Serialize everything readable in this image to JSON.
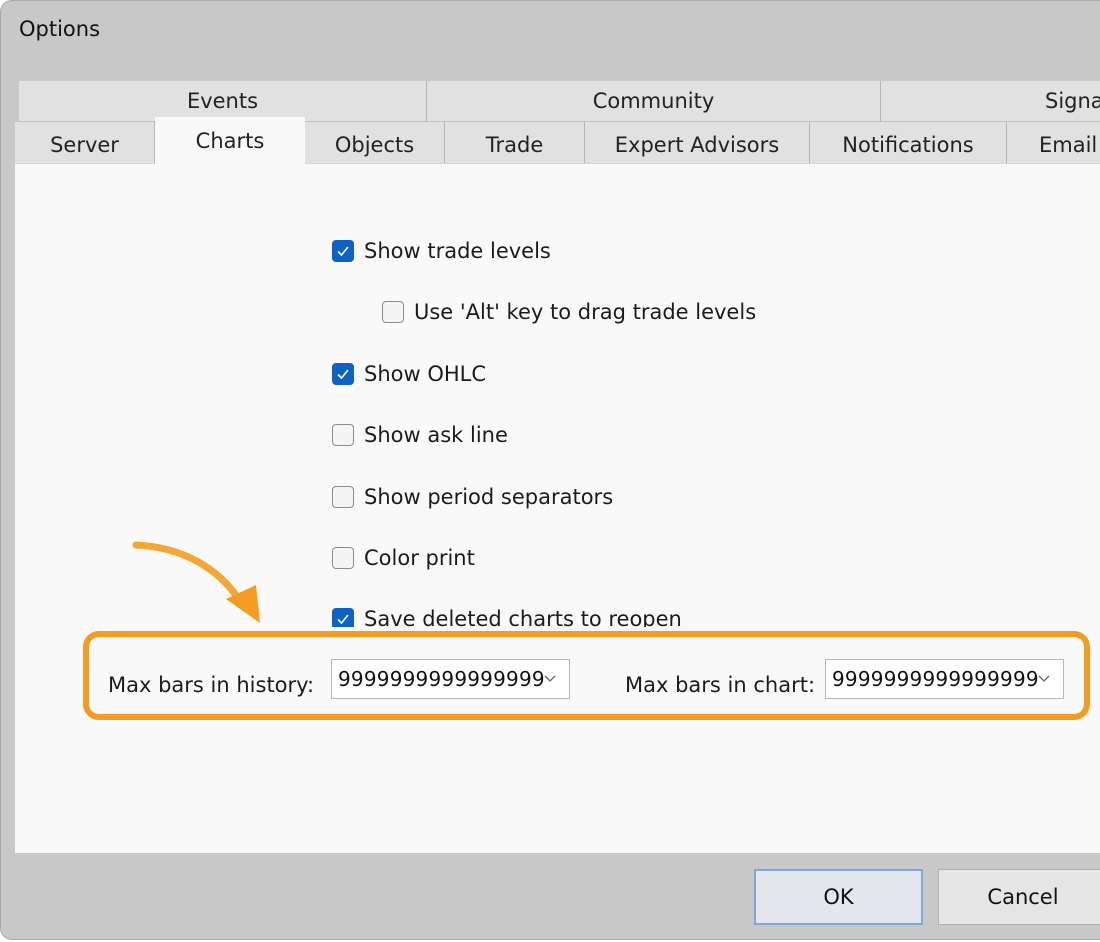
{
  "window": {
    "title": "Options"
  },
  "tabs": {
    "row1": [
      {
        "label": "Events"
      },
      {
        "label": "Community"
      },
      {
        "label": "Signa"
      }
    ],
    "row2": [
      {
        "label": "Server"
      },
      {
        "label": "Charts",
        "active": true
      },
      {
        "label": "Objects"
      },
      {
        "label": "Trade"
      },
      {
        "label": "Expert Advisors"
      },
      {
        "label": "Notifications"
      },
      {
        "label": "Email"
      }
    ]
  },
  "options": [
    {
      "label": "Show trade levels",
      "checked": true
    },
    {
      "label": "Use 'Alt' key to drag trade levels",
      "checked": false
    },
    {
      "label": "Show OHLC",
      "checked": true
    },
    {
      "label": "Show ask line",
      "checked": false
    },
    {
      "label": "Show period separators",
      "checked": false
    },
    {
      "label": "Color print",
      "checked": false
    },
    {
      "label": "Save deleted charts to reopen",
      "checked": true
    }
  ],
  "max_bars": {
    "history_label": "Max bars in history:",
    "history_value": "9999999999999999",
    "chart_label": "Max bars in chart:",
    "chart_value": "9999999999999999"
  },
  "buttons": {
    "ok": "OK",
    "cancel": "Cancel"
  },
  "colors": {
    "highlight": "#f39c21",
    "checkbox_checked": "#0f62c4"
  },
  "icons": [
    "checkmark-icon",
    "chevron-down-icon",
    "curved-arrow-icon"
  ]
}
